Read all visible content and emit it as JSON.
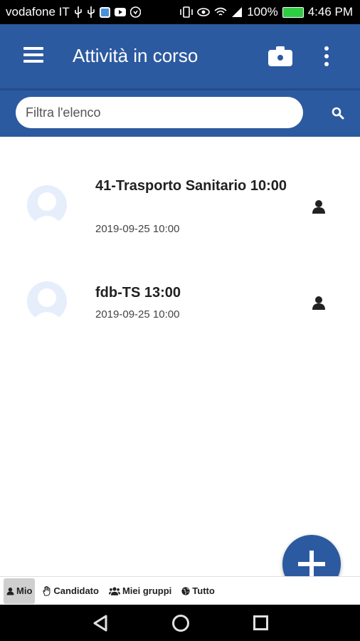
{
  "status_bar": {
    "carrier": "vodafone IT",
    "battery": "100%",
    "time": "4:46 PM"
  },
  "header": {
    "title": "Attività in corso"
  },
  "search": {
    "placeholder": "Filtra l'elenco",
    "value": ""
  },
  "items": [
    {
      "title": "41-Trasporto Sanitario 10:00",
      "date": "2019-09-25 10:00"
    },
    {
      "title": "fdb-TS 13:00",
      "date": "2019-09-25 10:00"
    }
  ],
  "tabs": [
    {
      "label": "Mio",
      "icon": "user-icon",
      "active": true
    },
    {
      "label": "Candidato",
      "icon": "hand-icon",
      "active": false
    },
    {
      "label": "Miei gruppi",
      "icon": "group-icon",
      "active": false
    },
    {
      "label": "Tutto",
      "icon": "globe-icon",
      "active": false
    }
  ],
  "colors": {
    "primary": "#2c5aa0",
    "avatar": "#e6eefc"
  }
}
